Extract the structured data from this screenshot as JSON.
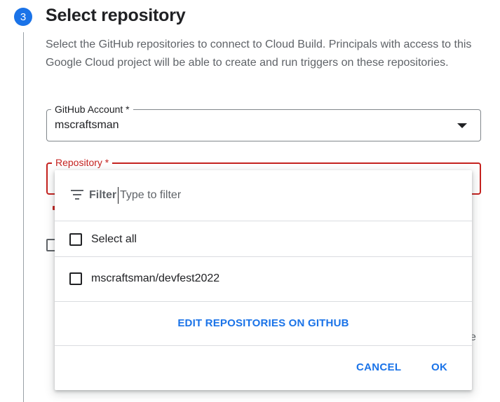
{
  "step": {
    "number": "3",
    "title": "Select repository",
    "description": "Select the GitHub repositories to connect to Cloud Build. Principals with access to this Google Cloud project will be able to create and run triggers on these repositories."
  },
  "account_field": {
    "label": "GitHub Account *",
    "value": "mscraftsman"
  },
  "repository_field": {
    "label": "Repository *"
  },
  "background": {
    "partial_letter": "e"
  },
  "dropdown": {
    "filter_label": "Filter",
    "filter_placeholder": "Type to filter",
    "options": [
      {
        "label": "Select all",
        "checked": false
      },
      {
        "label": "mscraftsman/devfest2022",
        "checked": false
      }
    ],
    "edit_link": "EDIT REPOSITORIES ON GITHUB",
    "cancel_label": "CANCEL",
    "ok_label": "OK"
  },
  "colors": {
    "accent": "#1a73e8",
    "error": "#c5221f"
  }
}
